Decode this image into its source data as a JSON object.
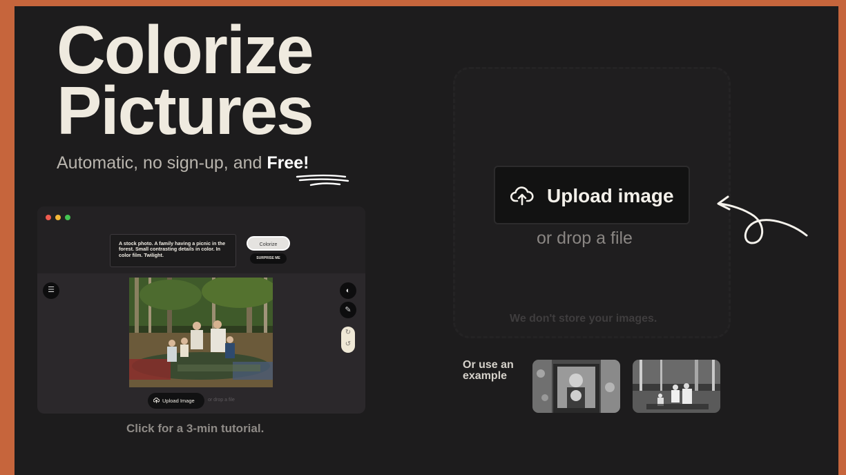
{
  "hero": {
    "title_line1": "Colorize",
    "title_line2": "Pictures",
    "subtitle_prefix": "Automatic, no sign-up, and ",
    "subtitle_emphasis": "Free!"
  },
  "tutorial": {
    "prompt_text": "A stock photo. A family having a picnic in the forest. Small contrasting details in color. In color film. Twilight.",
    "colorize_label": "Colorize",
    "surprise_label": "SURPRISE ME",
    "upload_label": "Upload Image",
    "drop_label": "or drop a file",
    "caption": "Click for a 3-min tutorial."
  },
  "upload": {
    "button_label": "Upload image",
    "drop_label": "or drop a file",
    "privacy_note": "We don't store your images."
  },
  "examples": {
    "label": "Or use an example"
  },
  "colors": {
    "background": "#1d1c1d",
    "frame": "#c6653c",
    "title": "#efeadf"
  }
}
